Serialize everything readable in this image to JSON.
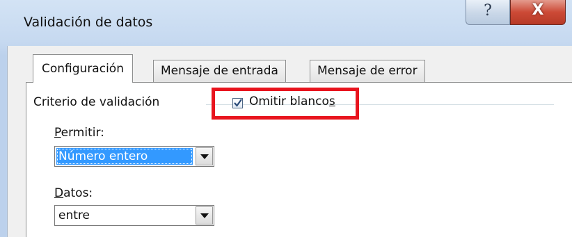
{
  "window": {
    "title": "Validación de datos",
    "help_glyph": "?",
    "close_glyph": "X"
  },
  "tabs": [
    {
      "label": "Configuración",
      "active": true
    },
    {
      "label": "Mensaje de entrada",
      "active": false
    },
    {
      "label": "Mensaje de error",
      "active": false
    }
  ],
  "settings": {
    "group_label": "Criterio de validación",
    "allow": {
      "label_mnemonic": "P",
      "label_rest": "ermitir:",
      "value": "Número entero"
    },
    "ignore_blank": {
      "label_main": "Omitir blanco",
      "label_mnemonic": "s",
      "checked": true
    },
    "data": {
      "label_mnemonic": "D",
      "label_rest": "atos:",
      "value": "entre"
    }
  },
  "colors": {
    "highlight": "#e8141e",
    "selection": "#3399ff",
    "close_button": "#cc4a36"
  },
  "icons": [
    "help-icon",
    "close-icon",
    "dropdown-arrow-icon",
    "checkmark-icon"
  ]
}
